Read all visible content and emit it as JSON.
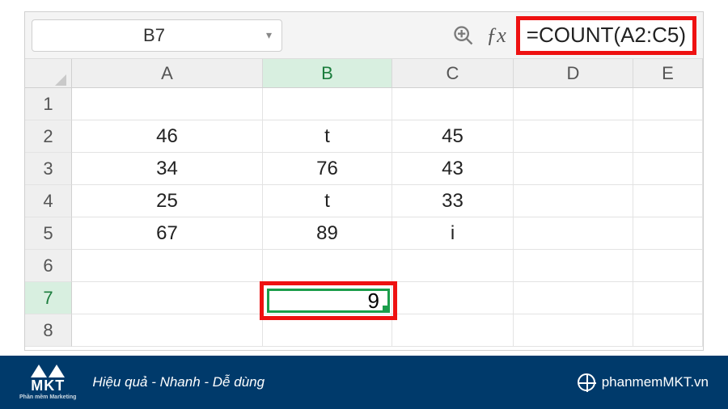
{
  "formula_bar": {
    "cell_reference": "B7",
    "formula": "=COUNT(A2:C5)"
  },
  "columns": [
    "A",
    "B",
    "C",
    "D",
    "E"
  ],
  "active_column_index": 1,
  "active_row_index": 6,
  "rows": [
    {
      "num": "1",
      "cells": [
        "",
        "",
        "",
        "",
        ""
      ]
    },
    {
      "num": "2",
      "cells": [
        "46",
        "t",
        "45",
        "",
        ""
      ]
    },
    {
      "num": "3",
      "cells": [
        "34",
        "76",
        "43",
        "",
        ""
      ]
    },
    {
      "num": "4",
      "cells": [
        "25",
        "t",
        "33",
        "",
        ""
      ]
    },
    {
      "num": "5",
      "cells": [
        "67",
        "89",
        "i",
        "",
        ""
      ]
    },
    {
      "num": "6",
      "cells": [
        "",
        "",
        "",
        "",
        ""
      ]
    },
    {
      "num": "7",
      "cells": [
        "",
        "9",
        "",
        "",
        ""
      ]
    },
    {
      "num": "8",
      "cells": [
        "",
        "",
        "",
        "",
        ""
      ]
    }
  ],
  "selected": {
    "row": 7,
    "col": "B",
    "display": "9"
  },
  "footer": {
    "brand": "MKT",
    "brand_sub": "Phần mềm Marketing",
    "tagline": "Hiệu quả - Nhanh  - Dễ dùng",
    "url": "phanmemMKT.vn"
  }
}
